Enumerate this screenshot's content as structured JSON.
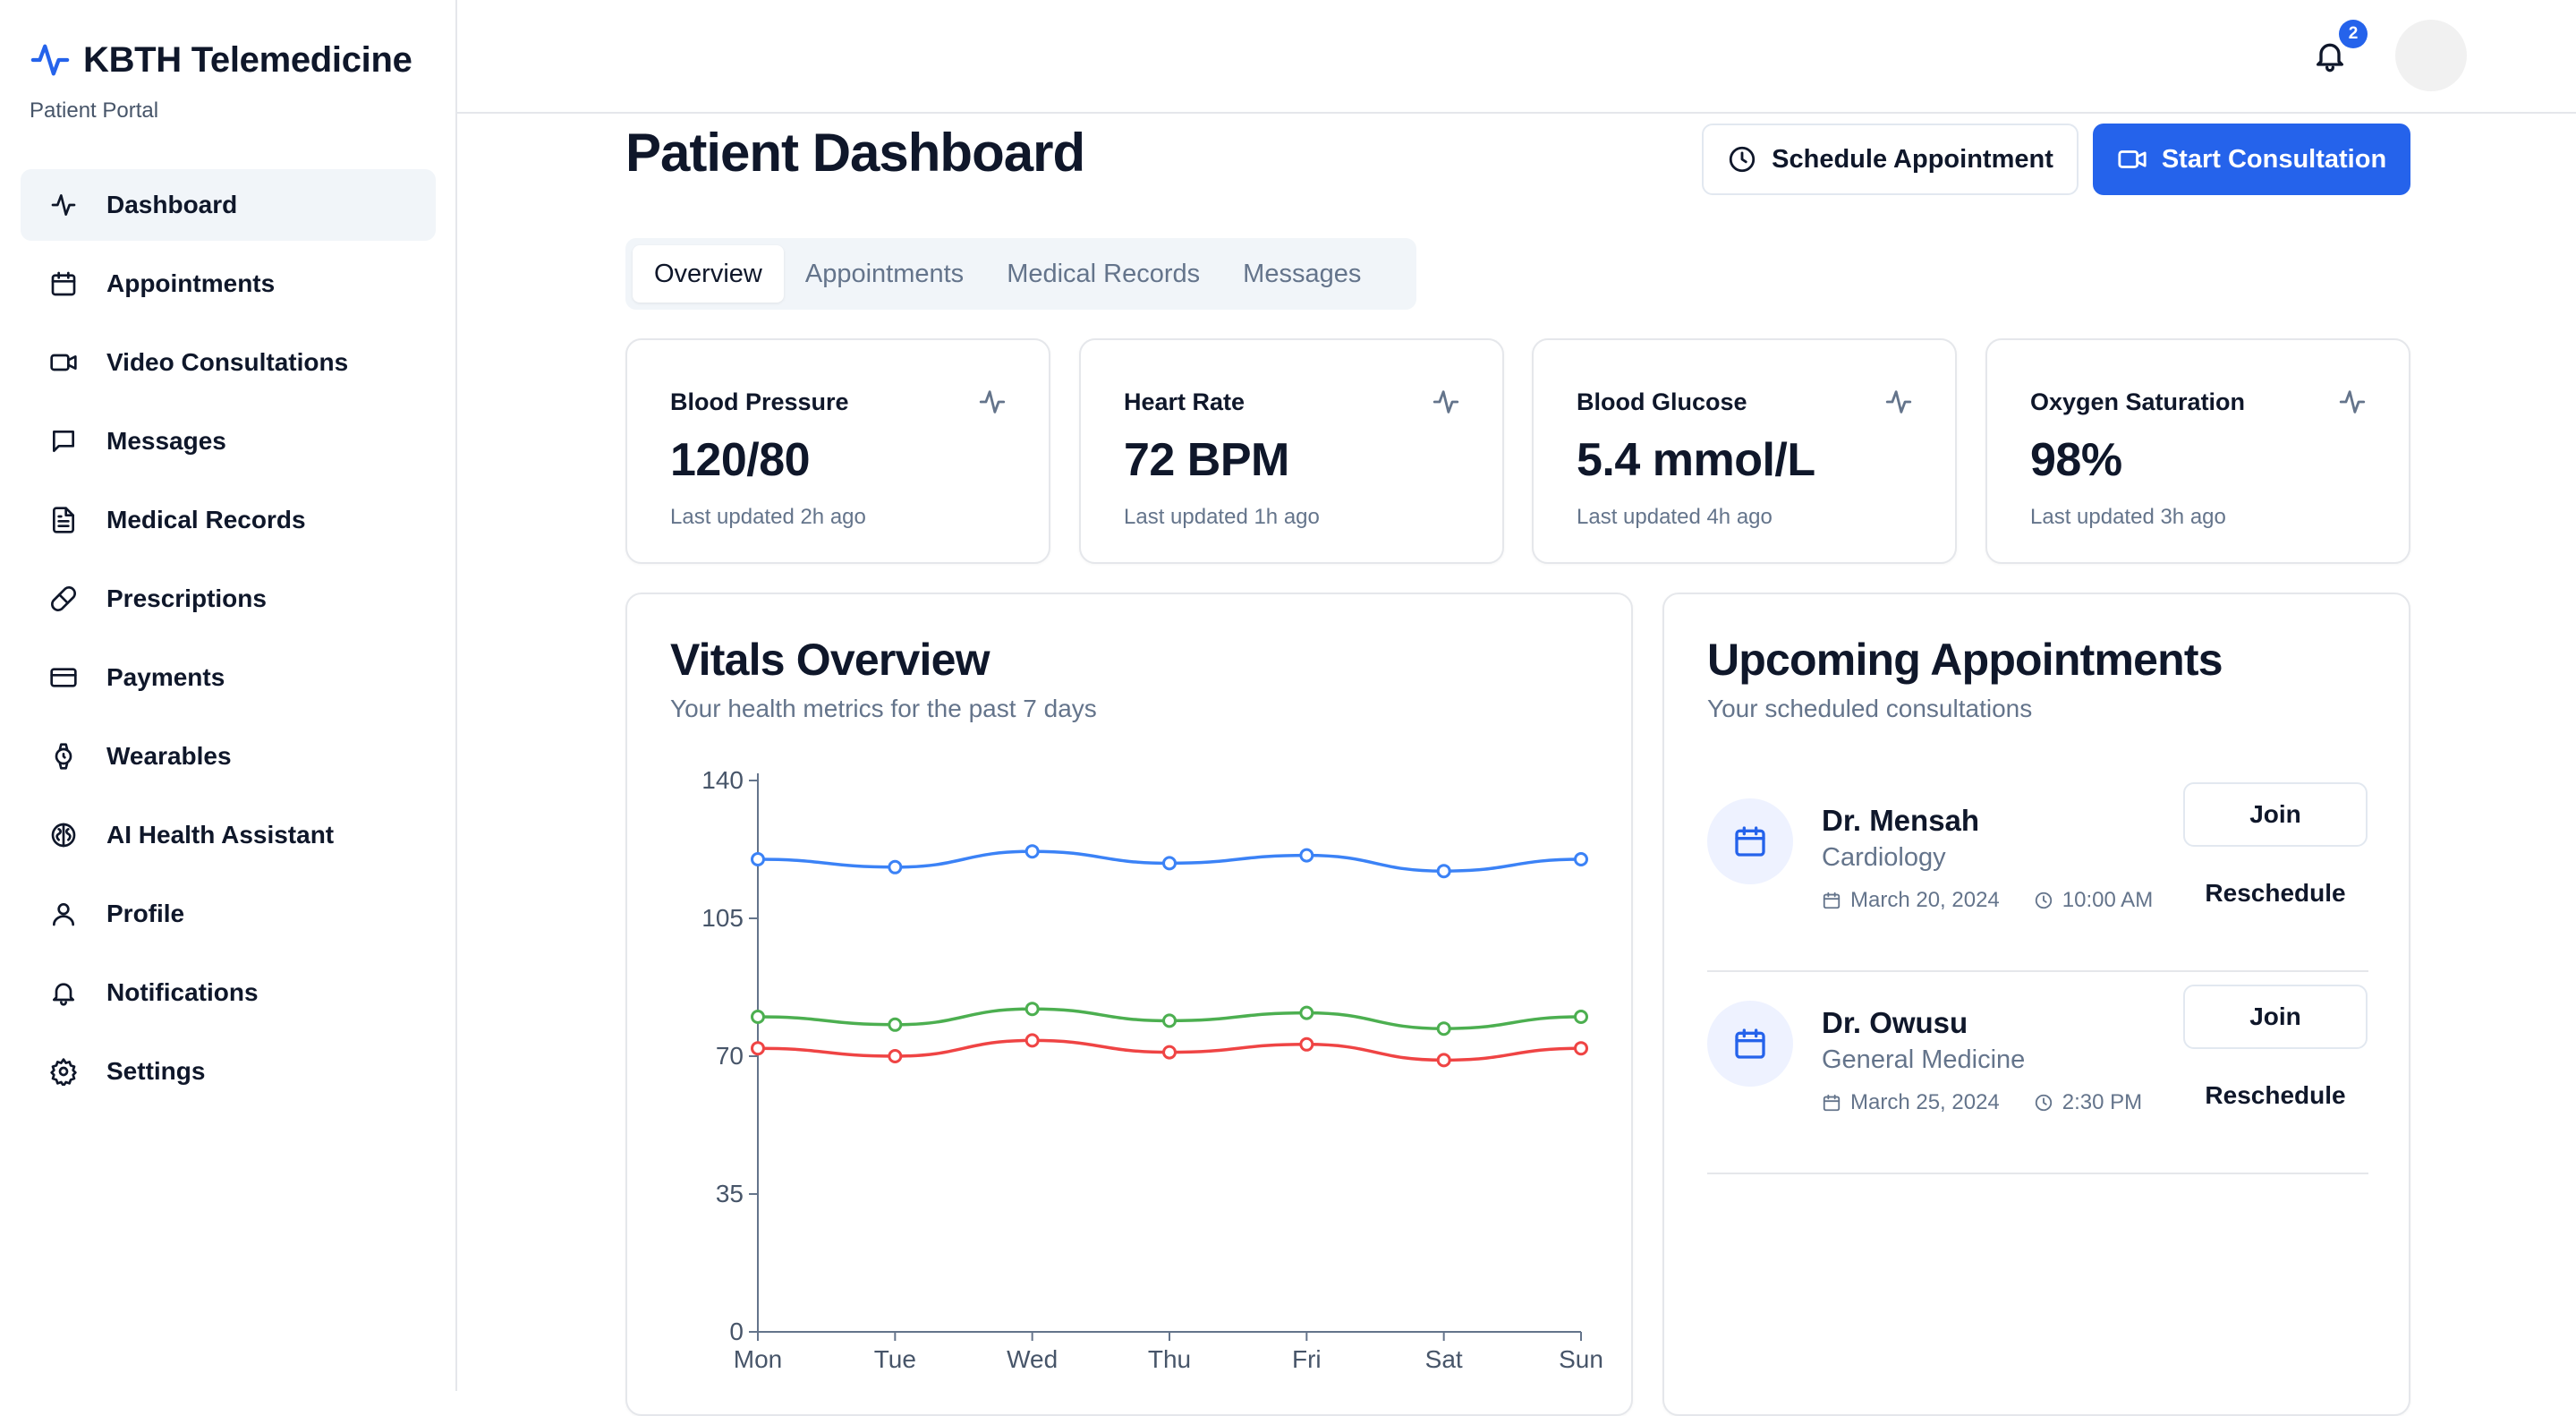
{
  "brand": {
    "title": "KBTH Telemedicine",
    "subtitle": "Patient Portal",
    "accent": "#2563eb"
  },
  "sidebar": {
    "items": [
      {
        "label": "Dashboard",
        "icon": "activity-icon",
        "active": true
      },
      {
        "label": "Appointments",
        "icon": "calendar-icon"
      },
      {
        "label": "Video Consultations",
        "icon": "video-icon"
      },
      {
        "label": "Messages",
        "icon": "message-icon"
      },
      {
        "label": "Medical Records",
        "icon": "file-icon"
      },
      {
        "label": "Prescriptions",
        "icon": "pill-icon"
      },
      {
        "label": "Payments",
        "icon": "credit-card-icon"
      },
      {
        "label": "Wearables",
        "icon": "watch-icon"
      },
      {
        "label": "AI Health Assistant",
        "icon": "brain-icon"
      },
      {
        "label": "Profile",
        "icon": "user-icon"
      },
      {
        "label": "Notifications",
        "icon": "bell-icon"
      },
      {
        "label": "Settings",
        "icon": "gear-icon"
      }
    ]
  },
  "topbar": {
    "notification_count": "2"
  },
  "header": {
    "title": "Patient Dashboard",
    "schedule_label": "Schedule Appointment",
    "consult_label": "Start Consultation"
  },
  "tabs": [
    {
      "label": "Overview",
      "active": true
    },
    {
      "label": "Appointments"
    },
    {
      "label": "Medical Records"
    },
    {
      "label": "Messages"
    }
  ],
  "stats": [
    {
      "label": "Blood Pressure",
      "value": "120/80",
      "updated": "Last updated 2h ago"
    },
    {
      "label": "Heart Rate",
      "value": "72 BPM",
      "updated": "Last updated 1h ago"
    },
    {
      "label": "Blood Glucose",
      "value": "5.4 mmol/L",
      "updated": "Last updated 4h ago"
    },
    {
      "label": "Oxygen Saturation",
      "value": "98%",
      "updated": "Last updated 3h ago"
    }
  ],
  "vitals": {
    "title": "Vitals Overview",
    "subtitle": "Your health metrics for the past 7 days"
  },
  "chart_data": {
    "type": "line",
    "categories": [
      "Mon",
      "Tue",
      "Wed",
      "Thu",
      "Fri",
      "Sat",
      "Sun"
    ],
    "ylim": [
      0,
      140
    ],
    "yticks": [
      0,
      35,
      70,
      105,
      140
    ],
    "series": [
      {
        "color": "#3b82f6",
        "values": [
          120,
          118,
          122,
          119,
          121,
          117,
          120
        ]
      },
      {
        "color": "#4caf50",
        "values": [
          80,
          78,
          82,
          79,
          81,
          77,
          80
        ]
      },
      {
        "color": "#ef4444",
        "values": [
          72,
          70,
          74,
          71,
          73,
          69,
          72
        ]
      }
    ]
  },
  "appointments": {
    "title": "Upcoming Appointments",
    "subtitle": "Your scheduled consultations",
    "items": [
      {
        "doctor": "Dr. Mensah",
        "specialty": "Cardiology",
        "date": "March 20, 2024",
        "time": "10:00 AM",
        "join": "Join",
        "reschedule": "Reschedule"
      },
      {
        "doctor": "Dr. Owusu",
        "specialty": "General Medicine",
        "date": "March 25, 2024",
        "time": "2:30 PM",
        "join": "Join",
        "reschedule": "Reschedule"
      }
    ]
  }
}
